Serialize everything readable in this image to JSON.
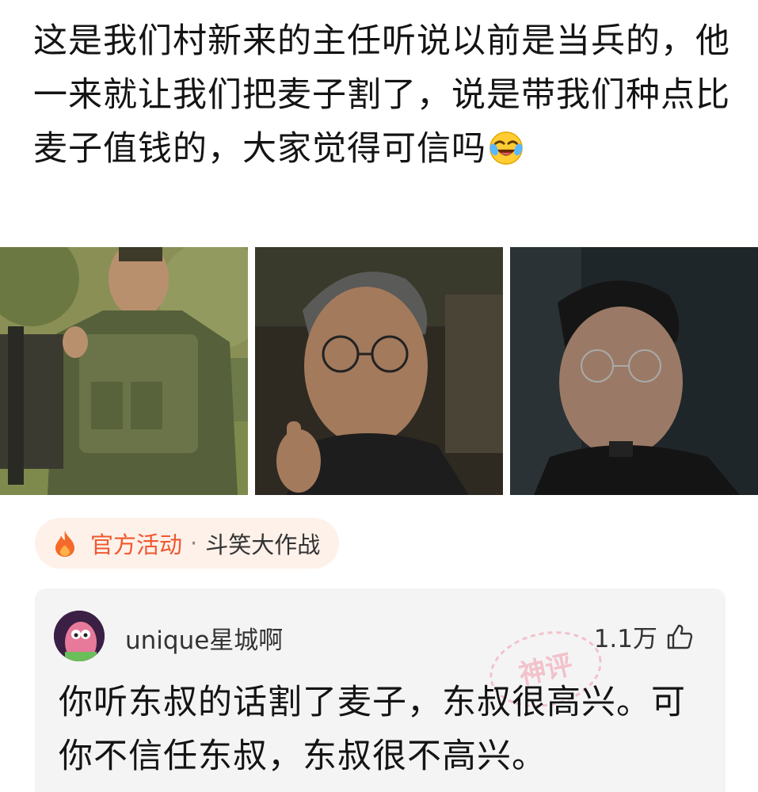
{
  "post": {
    "text": "这是我们村新来的主任听说以前是当兵的，他一来就让我们把麦子割了，说是带我们种点比麦子值钱的，大家觉得可信吗",
    "emoji": "rolling-laughing-emoji"
  },
  "images": [
    {
      "subject": "soldier-in-camouflage-with-rifle"
    },
    {
      "subject": "man-with-glasses-pointing"
    },
    {
      "subject": "man-with-glasses-dark-background"
    }
  ],
  "tag": {
    "icon": "fire-icon",
    "activity": "官方活动",
    "separator": "·",
    "topic": "斗笑大作战"
  },
  "comment": {
    "username": "unique星城啊",
    "likes": "1.1万",
    "badge": "神评",
    "text": "你听东叔的话割了麦子，东叔很高兴。可你不信任东叔，东叔很不高兴。"
  },
  "colors": {
    "accent": "#f0582d",
    "tag_bg": "#fdf1ea",
    "card_bg": "#f4f4f5"
  }
}
